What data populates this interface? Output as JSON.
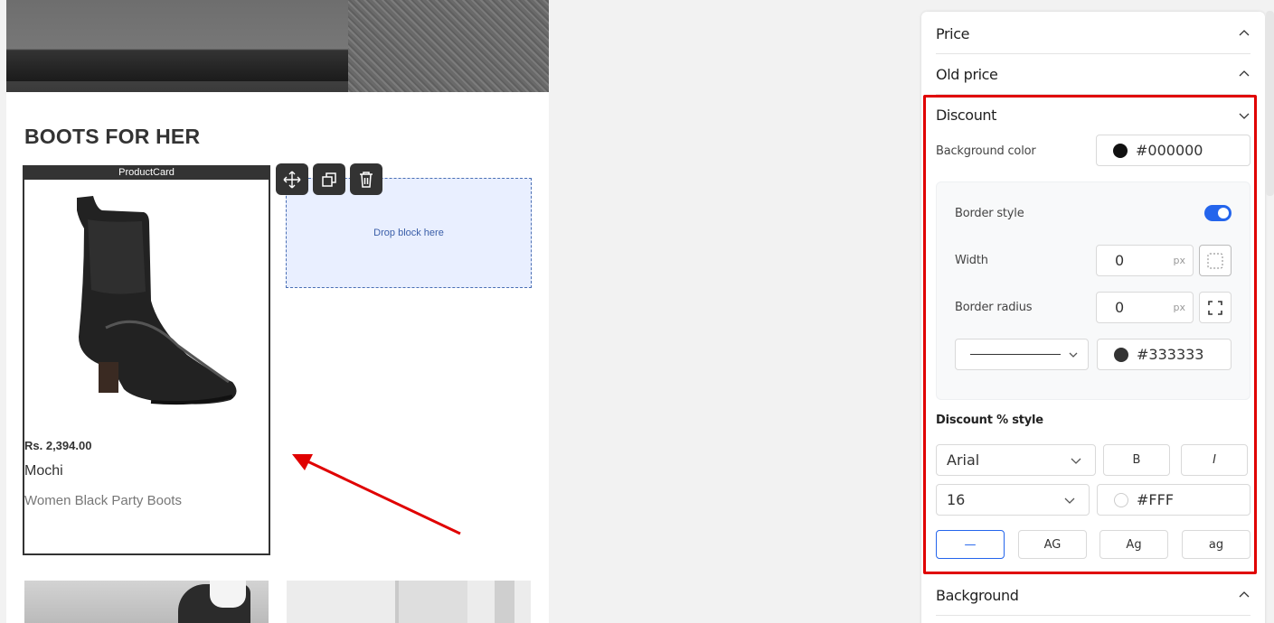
{
  "canvas": {
    "section_title": "BOOTS FOR HER",
    "card_tag": "ProductCard",
    "product": {
      "price": "Rs. 2,394.00",
      "brand": "Mochi",
      "name": "Women Black Party Boots"
    },
    "dropzone_label": "Drop block here",
    "toolbar": [
      "move-icon",
      "duplicate-icon",
      "delete-icon"
    ]
  },
  "panel": {
    "sections": {
      "price": "Price",
      "old_price": "Old price",
      "discount": "Discount",
      "background": "Background"
    },
    "discount": {
      "background_color_label": "Background color",
      "background_color_value": "#000000",
      "border_style_label": "Border style",
      "border_style_enabled": true,
      "width_label": "Width",
      "width_value": "0",
      "width_unit": "px",
      "radius_label": "Border radius",
      "radius_value": "0",
      "radius_unit": "px",
      "border_color_value": "#333333",
      "pct_style_label": "Discount % style",
      "font_value": "Arial",
      "bold_label": "B",
      "italic_label": "I",
      "size_value": "16",
      "text_color_value": "#FFF",
      "case_options": [
        "—",
        "AG",
        "Ag",
        "ag"
      ],
      "case_selected": "—"
    }
  },
  "colors": {
    "accent": "#2465ec",
    "highlight": "#e00000",
    "discount_bg": "#000000",
    "border_color": "#333333",
    "text_color": "#FFFFFF"
  }
}
